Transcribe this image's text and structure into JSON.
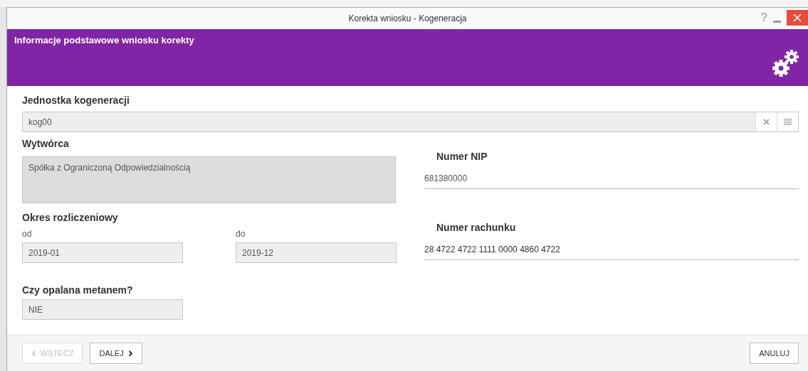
{
  "window": {
    "title": "Korekta wniosku - Kogeneracja",
    "controls": [
      "?"
    ]
  },
  "header": {
    "title": "Informacje podstawowe wniosku korekty"
  },
  "unit": {
    "label": "Jednostka kogeneracji",
    "value": "kog00"
  },
  "producer": {
    "label": "Wytwórca",
    "value": "Spółka z Ograniczoną Odpowiedzialnością"
  },
  "period": {
    "label": "Okres rozliczeniowy",
    "from": {
      "label": "od",
      "value": "2019-01"
    },
    "to": {
      "label": "do",
      "value": "2019-12"
    }
  },
  "methane": {
    "label": "Czy opalana metanem?",
    "value": "NIE"
  },
  "nip": {
    "label": "Numer NIP",
    "value": "681380000"
  },
  "account": {
    "label": "Numer rachunku",
    "value": "28 4722 4722 1111 0000 4860 4722"
  },
  "footer": {
    "buttons": [
      {
        "kind": "back",
        "label": "WSTECZ",
        "disabled": true
      },
      {
        "kind": "next",
        "label": "DALEJ",
        "disabled": false
      },
      {
        "kind": "cancel",
        "label": "ANULUJ",
        "disabled": false
      }
    ]
  }
}
